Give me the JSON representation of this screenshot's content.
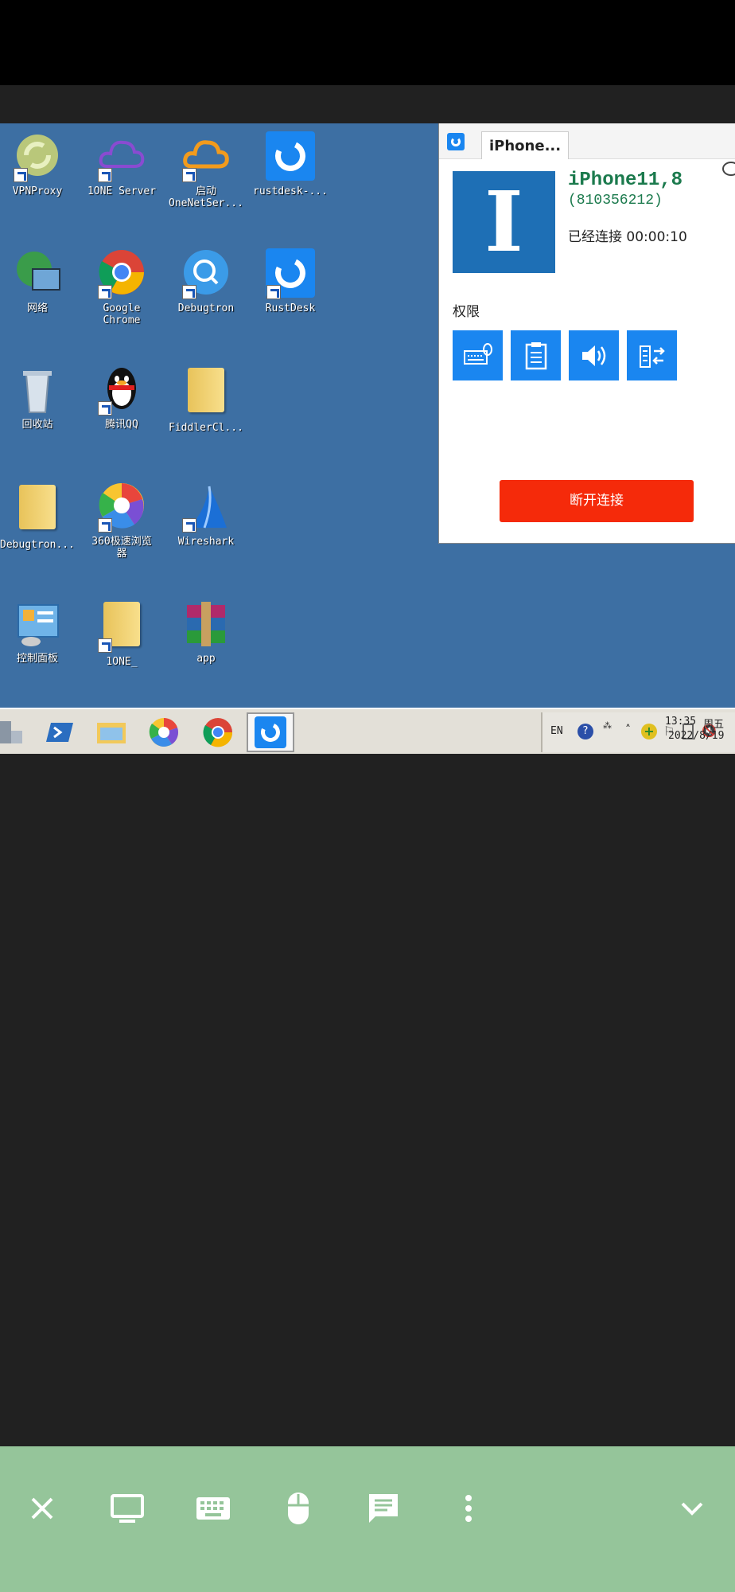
{
  "desktop_icons": [
    {
      "label": "VPNProxy"
    },
    {
      "label": "1ONE Server"
    },
    {
      "label": "启动",
      "label2": "OneNetSer..."
    },
    {
      "label": "rustdesk-..."
    },
    {
      "label": "网络"
    },
    {
      "label": "Google",
      "label2": "Chrome"
    },
    {
      "label": "Debugtron"
    },
    {
      "label": "RustDesk"
    },
    {
      "label": "回收站"
    },
    {
      "label": "腾讯QQ"
    },
    {
      "label": "FiddlerCl..."
    },
    {
      "label": "Debugtron..."
    },
    {
      "label": "360极速浏览",
      "label2": "器"
    },
    {
      "label": "Wireshark"
    },
    {
      "label": "控制面板"
    },
    {
      "label": "1ONE_"
    },
    {
      "label": "app"
    }
  ],
  "panel": {
    "tab_title": "iPhone...",
    "avatar_letter": "I",
    "peer_name": "iPhone11,8",
    "peer_id": "(810356212)",
    "status": "已经连接 00:00:10",
    "permissions_title": "权限",
    "disconnect_label": "断开连接"
  },
  "taskbar": {
    "lang": "EN",
    "time": "13:35",
    "weekday": "周五",
    "date": "2022/8/19"
  },
  "bottom_toolbar": {
    "buttons": [
      "close-icon",
      "monitor-icon",
      "keyboard-icon",
      "mouse-icon",
      "chat-icon",
      "more-icon",
      "chevron-down-icon"
    ]
  },
  "colors": {
    "desktop_bg": "#3d6fa3",
    "toolbar_bg": "#95c59a",
    "rustdesk_blue": "#1a86f0",
    "disconnect_red": "#f52a0a",
    "peer_green": "#1b7a4d"
  }
}
